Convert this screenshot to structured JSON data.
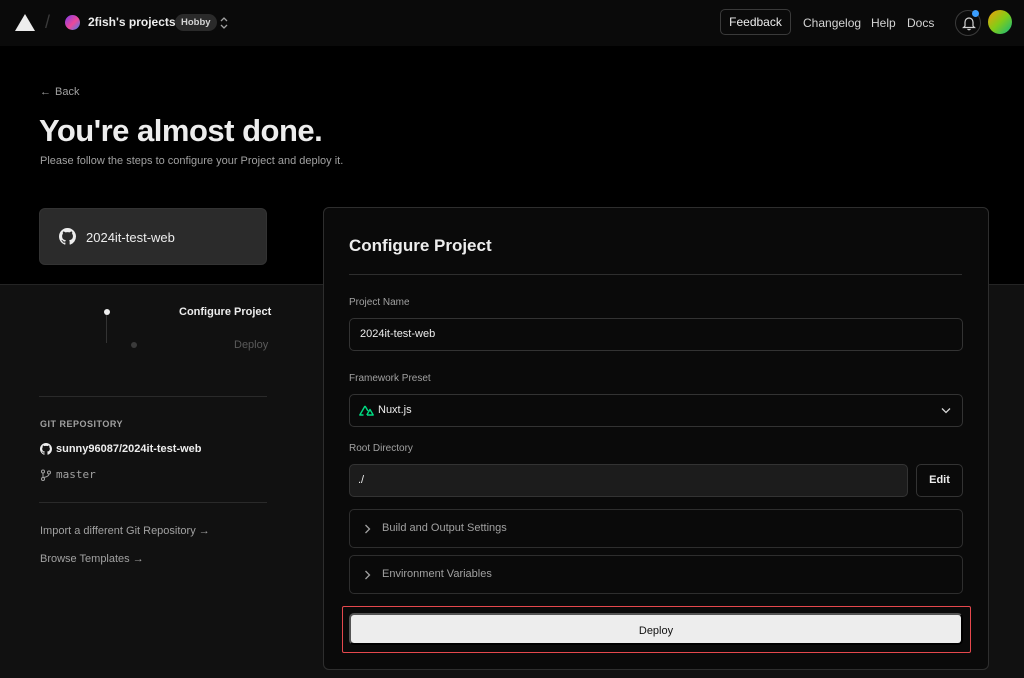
{
  "header": {
    "team_name": "2fish's projects",
    "plan_badge": "Hobby",
    "feedback_label": "Feedback",
    "nav": [
      "Changelog",
      "Help",
      "Docs"
    ]
  },
  "hero": {
    "back_label": "Back",
    "title": "You're almost done.",
    "subtitle": "Please follow the steps to configure your Project and deploy it.",
    "repo_card_name": "2024it-test-web"
  },
  "steps": [
    {
      "label": "Configure Project",
      "state": "active"
    },
    {
      "label": "Deploy",
      "state": "pending"
    }
  ],
  "git": {
    "heading": "GIT REPOSITORY",
    "repo": "sunny96087/2024it-test-web",
    "branch": "master"
  },
  "side_links": {
    "import_label": "Import a different Git Repository →",
    "templates_label": "Browse Templates →"
  },
  "config": {
    "title": "Configure Project",
    "project_name_label": "Project Name",
    "project_name_value": "2024it-test-web",
    "framework_label": "Framework Preset",
    "framework_value": "Nuxt.js",
    "root_dir_label": "Root Directory",
    "root_dir_value": "./",
    "edit_label": "Edit",
    "build_settings_label": "Build and Output Settings",
    "env_vars_label": "Environment Variables",
    "deploy_label": "Deploy"
  },
  "colors": {
    "background": "#000000",
    "panel": "#0a0a0a",
    "text": "#ededed",
    "muted": "#a1a1a1",
    "deploy_button": "#ededed",
    "highlight": "#e5484d",
    "nuxt_green": "#00dc82",
    "notification_dot": "#3b9eff"
  }
}
